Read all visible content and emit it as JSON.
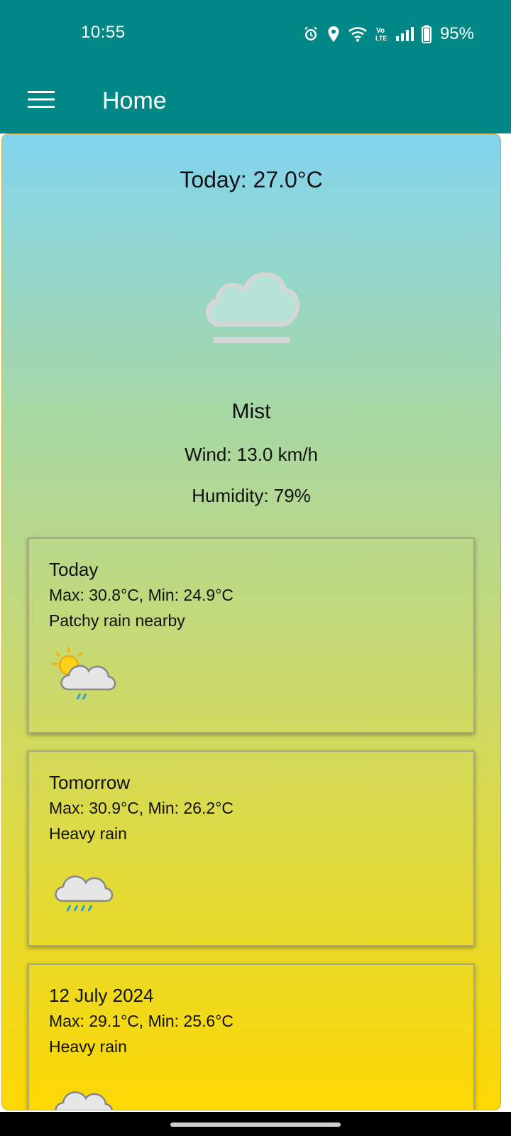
{
  "status_bar": {
    "time": "10:55",
    "battery": "95%",
    "icons": [
      "alarm-icon",
      "location-icon",
      "wifi-icon",
      "volte-icon",
      "signal-icon",
      "battery-icon"
    ]
  },
  "app_bar": {
    "title": "Home",
    "menu_icon": "hamburger-menu-icon",
    "background": "#018786"
  },
  "current": {
    "today_temp": "Today: 27.0°C",
    "condition": "Mist",
    "icon": "mist-cloud-icon",
    "wind": "Wind: 13.0 km/h",
    "humidity": "Humidity: 79%"
  },
  "forecast": [
    {
      "day": "Today",
      "range": "Max: 30.8°C, Min: 24.9°C",
      "description": "Patchy rain nearby",
      "icon": "sun-cloud-rain-icon"
    },
    {
      "day": "Tomorrow",
      "range": "Max: 30.9°C, Min: 26.2°C",
      "description": "Heavy rain",
      "icon": "heavy-rain-icon"
    },
    {
      "day": "12 July 2024",
      "range": "Max: 29.1°C, Min: 25.6°C",
      "description": "Heavy rain",
      "icon": "heavy-rain-icon"
    }
  ],
  "colors": {
    "gradient_top": "#82d4ef",
    "gradient_bottom": "#fdd803"
  }
}
